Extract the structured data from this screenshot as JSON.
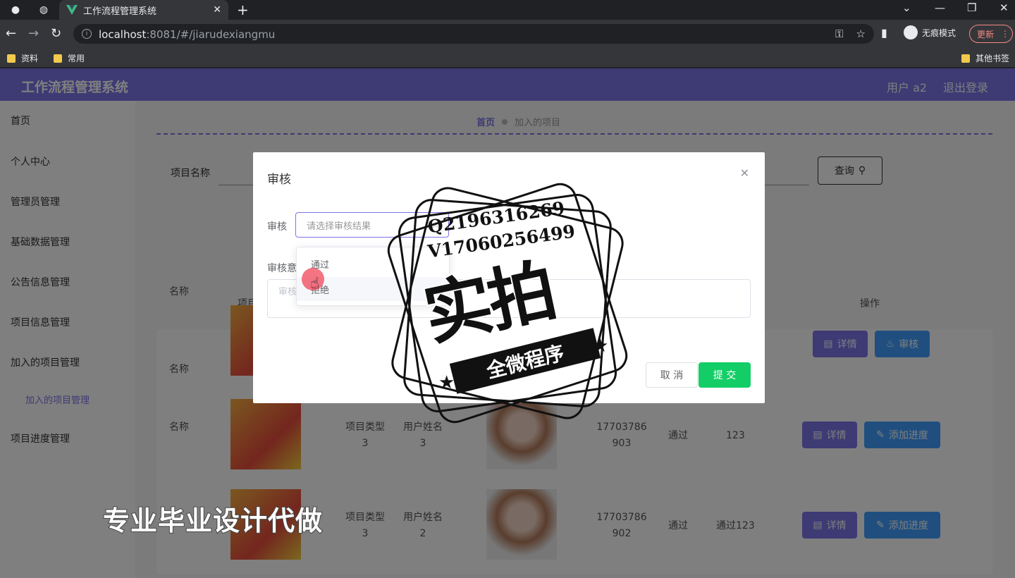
{
  "browser": {
    "tab_title": "工作流程管理系统",
    "url_host": "localhost",
    "url_rest": ":8081/#/jiarudexiangmu",
    "incognito_label": "无痕模式",
    "update_label": "更新",
    "bookmarks": [
      "资料",
      "常用"
    ],
    "other_bookmarks": "其他书签"
  },
  "header": {
    "title": "工作流程管理系统",
    "user": "用户 a2",
    "logout": "退出登录"
  },
  "sidebar": {
    "items": [
      "首页",
      "个人中心",
      "管理员管理",
      "基础数据管理",
      "公告信息管理",
      "项目信息管理",
      "加入的项目管理",
      "项目进度管理"
    ],
    "sub_item": "加入的项目管理"
  },
  "breadcrumb": {
    "home": "首页",
    "current": "加入的项目"
  },
  "search": {
    "label": "项目名称",
    "button": "查询"
  },
  "table": {
    "header_name": "名称",
    "header_project": "项目",
    "header_actions": "操作",
    "rows": [
      {
        "name": "名称",
        "details": "详情",
        "action": "审核"
      },
      {
        "name": "名称",
        "type": "项目类型",
        "type_val": "3",
        "uname": "用户姓名",
        "uname_val": "3",
        "phone": "17703786903",
        "status": "通过",
        "note": "123",
        "details": "详情",
        "action": "添加进度"
      },
      {
        "name": "名称",
        "type": "项目类型",
        "type_val": "3",
        "uname": "用户姓名",
        "uname_val": "2",
        "phone": "17703786902",
        "status": "通过",
        "note": "通过123",
        "details": "详情",
        "action": "添加进度"
      }
    ]
  },
  "dialog": {
    "title": "审核",
    "select_label": "审核",
    "select_placeholder": "请选择审核结果",
    "opinion_label": "审核意见",
    "opinion_placeholder": "审核意见",
    "options": [
      "通过",
      "拒绝"
    ],
    "cancel": "取 消",
    "submit": "提 交"
  },
  "watermark": {
    "line1": "Q2196316269",
    "line2": "V17060256499",
    "big": "实拍",
    "ribbon": "全微程序",
    "bottom": "专业毕业设计代做"
  }
}
